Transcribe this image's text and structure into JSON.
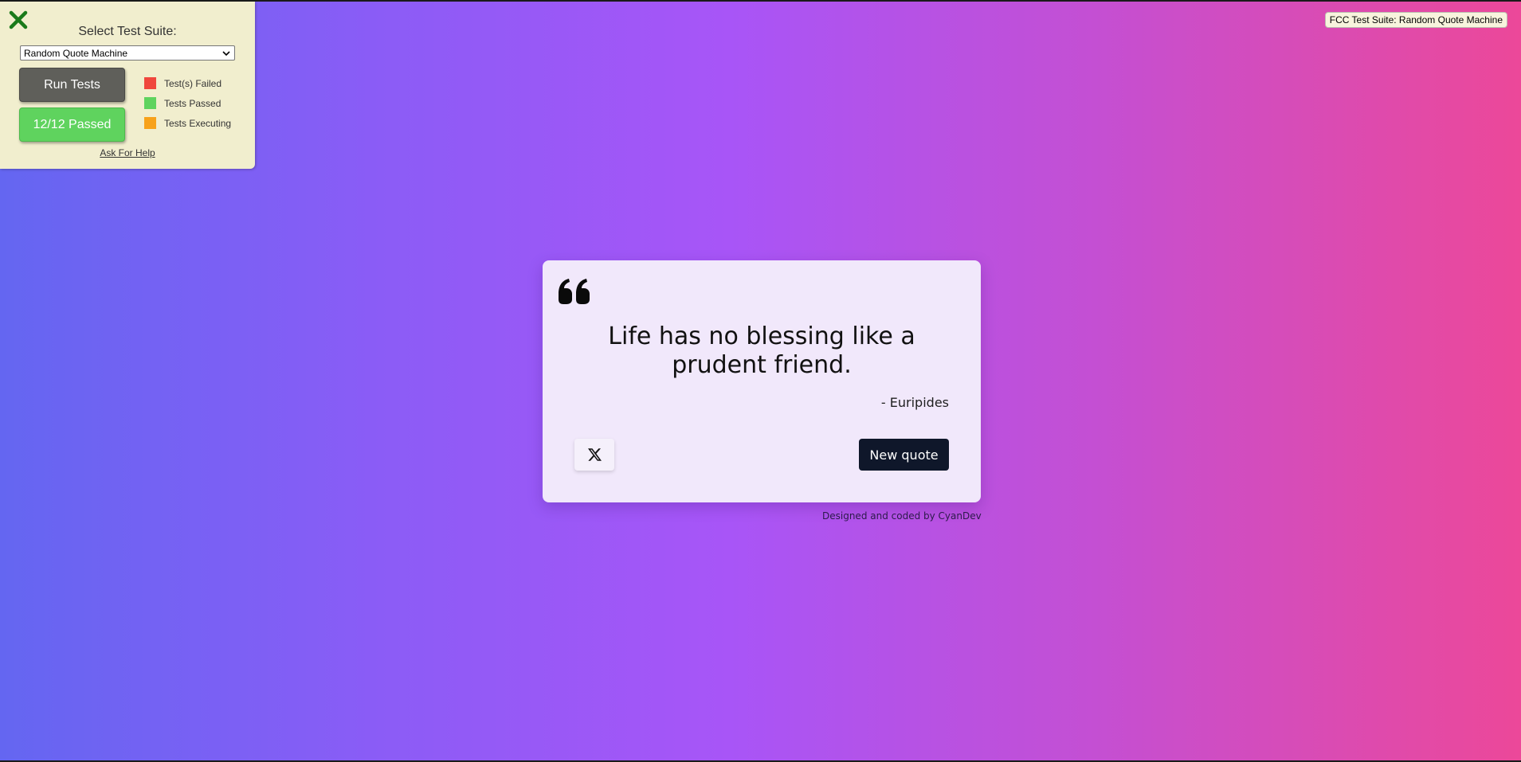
{
  "fcc_panel": {
    "title": "Select Test Suite:",
    "selected_suite": "Random Quote Machine",
    "run_tests_label": "Run Tests",
    "passed_label": "12/12 Passed",
    "legend": [
      {
        "label": "Test(s) Failed",
        "color": "#f0473d"
      },
      {
        "label": "Tests Passed",
        "color": "#5fd35e"
      },
      {
        "label": "Tests Executing",
        "color": "#f7a21b"
      }
    ],
    "help_link": "Ask For Help",
    "close_icon": "close-x-icon"
  },
  "badge": {
    "text": "FCC Test Suite: Random Quote Machine"
  },
  "quote": {
    "text": "Life has no blessing like a prudent friend.",
    "author": "- Euripides",
    "new_quote_label": "New quote",
    "tweet_icon": "x-logo-icon",
    "quote_icon": "quote-mark-icon"
  },
  "footer": {
    "credit": "Designed and coded by CyanDev"
  },
  "colors": {
    "gradient_start": "#6466f1",
    "gradient_mid": "#a855f7",
    "gradient_end": "#ec4899",
    "card_bg": "#f1e8fb",
    "button_dark": "#0f172a",
    "panel_bg": "#f1eece"
  }
}
